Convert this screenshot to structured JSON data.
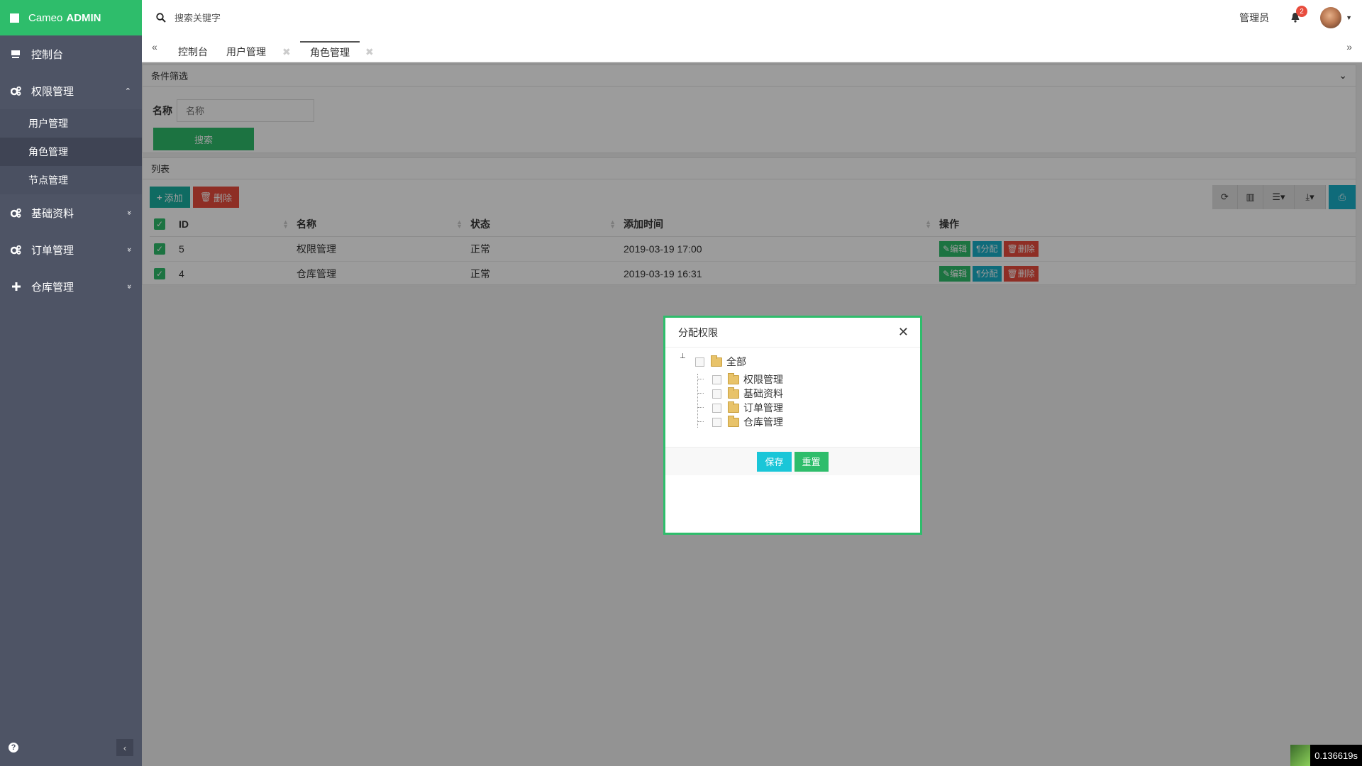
{
  "brand": {
    "name": "Cameo",
    "suffix": "ADMIN"
  },
  "sidebar": {
    "items": [
      {
        "label": "控制台",
        "icon": "dashboard-icon"
      },
      {
        "label": "权限管理",
        "icon": "gears-icon",
        "caret": "⌃"
      },
      {
        "label": "基础资料",
        "icon": "gears-icon",
        "caret": "»"
      },
      {
        "label": "订单管理",
        "icon": "gears-icon",
        "caret": "»"
      },
      {
        "label": "仓库管理",
        "icon": "plus-icon",
        "caret": "»"
      }
    ],
    "subitems": [
      "用户管理",
      "角色管理",
      "节点管理"
    ]
  },
  "topbar": {
    "search_placeholder": "搜索关键字",
    "user": "管理员",
    "notifications": "2"
  },
  "tabs": {
    "items": [
      "控制台",
      "用户管理",
      "角色管理"
    ],
    "prev": "«",
    "next": "»"
  },
  "filter": {
    "title": "条件筛选",
    "name_label": "名称",
    "name_placeholder": "名称",
    "search_label": "搜索"
  },
  "list": {
    "title": "列表",
    "add_label": "添加",
    "delete_label": "删除",
    "columns": [
      "ID",
      "名称",
      "状态",
      "添加时间",
      "操作"
    ],
    "rows": [
      {
        "id": "5",
        "name": "权限管理",
        "status": "正常",
        "time": "2019-03-19 17:00"
      },
      {
        "id": "4",
        "name": "仓库管理",
        "status": "正常",
        "time": "2019-03-19 16:31"
      }
    ],
    "row_actions": {
      "edit": "编辑",
      "assign": "分配",
      "delete": "删除"
    }
  },
  "modal": {
    "title": "分配权限",
    "tree_root": "全部",
    "tree_children": [
      "权限管理",
      "基础资料",
      "订单管理",
      "仓库管理"
    ],
    "save_label": "保存",
    "reset_label": "重置"
  },
  "timer": "0.136619s",
  "colors": {
    "accent": "#2ebd6b",
    "sidebar": "#4e5465",
    "danger": "#e84c3d",
    "info": "#1ab0c8"
  }
}
